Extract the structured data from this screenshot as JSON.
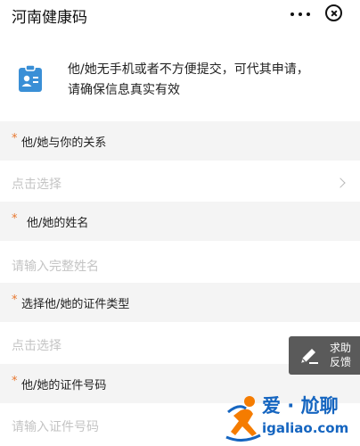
{
  "header": {
    "title": "河南健康码"
  },
  "notice": {
    "line1": "他/她无手机或者不方便提交，可代其申请，",
    "line2": "请确保信息真实有效"
  },
  "form": {
    "required_mark": "*",
    "fields": [
      {
        "label": "他/她与你的关系",
        "placeholder": "点击选择"
      },
      {
        "label": "他/她的姓名",
        "placeholder": "请输入完整姓名"
      },
      {
        "label": "选择他/她的证件类型",
        "placeholder": "点击选择"
      },
      {
        "label": "他/她的证件号码",
        "placeholder": "请输入证件号码"
      }
    ]
  },
  "help_button": {
    "label": "求助反馈"
  },
  "watermark": {
    "title": "爱 · 尬聊",
    "url": "igaliao.com"
  },
  "icons": {
    "more": "more-dots-icon",
    "close": "close-circle-icon",
    "notice": "id-card-clipboard-icon",
    "chevron": "chevron-right-icon",
    "edit": "pen-edit-icon",
    "watermark_logo": "running-figure-logo"
  },
  "colors": {
    "accent": "#3a8fd6",
    "required_star": "#e8772e",
    "label_bg": "#f4f4f4",
    "placeholder": "#c4c4c4",
    "help_bg": "#5a5a5a",
    "watermark": "#1565c0"
  }
}
